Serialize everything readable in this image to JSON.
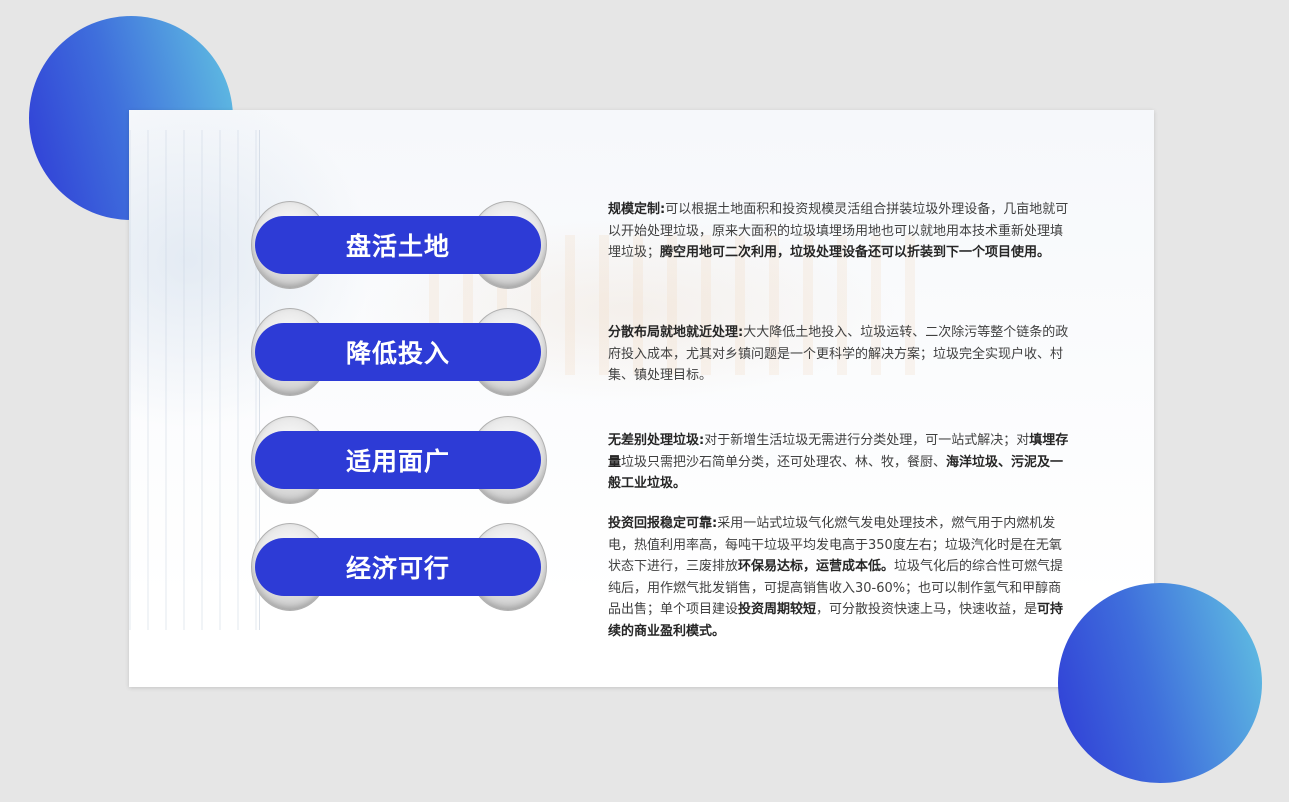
{
  "items": [
    {
      "label": "盘活土地",
      "desc": [
        {
          "t": "规模定制:",
          "b": true
        },
        {
          "t": "可以根据土地面积和投资规模灵活组合拼装垃圾外理设备，几亩地就可以开始处理垃圾，原来大面积的垃圾填埋场用地也可以就地用本技术重新处理填埋垃圾；",
          "b": false
        },
        {
          "t": "腾空用地可二次利用，垃圾处理设备还可以折装到下一个项目使用。",
          "b": true
        }
      ]
    },
    {
      "label": "降低投入",
      "desc": [
        {
          "t": "分散布局就地就近处理:",
          "b": true
        },
        {
          "t": "大大降低土地投入、垃圾运转、二次除污等整个链条的政府投入成本，尤其对乡镇问题是一个更科学的解决方案；垃圾完全实现户收、村集、镇处理目标。",
          "b": false
        }
      ]
    },
    {
      "label": "适用面广",
      "desc": [
        {
          "t": "无差别处理垃圾:",
          "b": true
        },
        {
          "t": "对于新增生活垃圾无需进行分类处理，可一站式解决；对",
          "b": false
        },
        {
          "t": "填埋存量",
          "b": true
        },
        {
          "t": "垃圾只需把沙石简单分类，还可处理农、林、牧，餐厨、",
          "b": false
        },
        {
          "t": "海洋垃圾、污泥及一般工业垃圾。",
          "b": true
        }
      ]
    },
    {
      "label": "经济可行",
      "desc": [
        {
          "t": "投资回报稳定可靠:",
          "b": true
        },
        {
          "t": "采用一站式垃圾气化燃气发电处理技术，燃气用于内燃机发电，热值利用率高，每吨干垃圾平均发电高于350度左右；垃圾汽化时是在无氧状态下进行，三废排放",
          "b": false
        },
        {
          "t": "环保易达标，运营成本低。",
          "b": true
        },
        {
          "t": "垃圾气化后的综合性可燃气提纯后，用作燃气批发销售，可提高销售收入30-60%；也可以制作氢气和甲醇商品出售；单个项目建设",
          "b": false
        },
        {
          "t": "投资周期较短",
          "b": true
        },
        {
          "t": "，可分散投资快速上马，快速收益，是",
          "b": false
        },
        {
          "t": "可持续的商业盈利模式。",
          "b": true
        }
      ]
    }
  ],
  "colors": {
    "pill": "#2d3bd6",
    "circle_start": "#2f3bd6",
    "circle_end": "#62c3e2",
    "page_bg": "#e6e6e6"
  }
}
